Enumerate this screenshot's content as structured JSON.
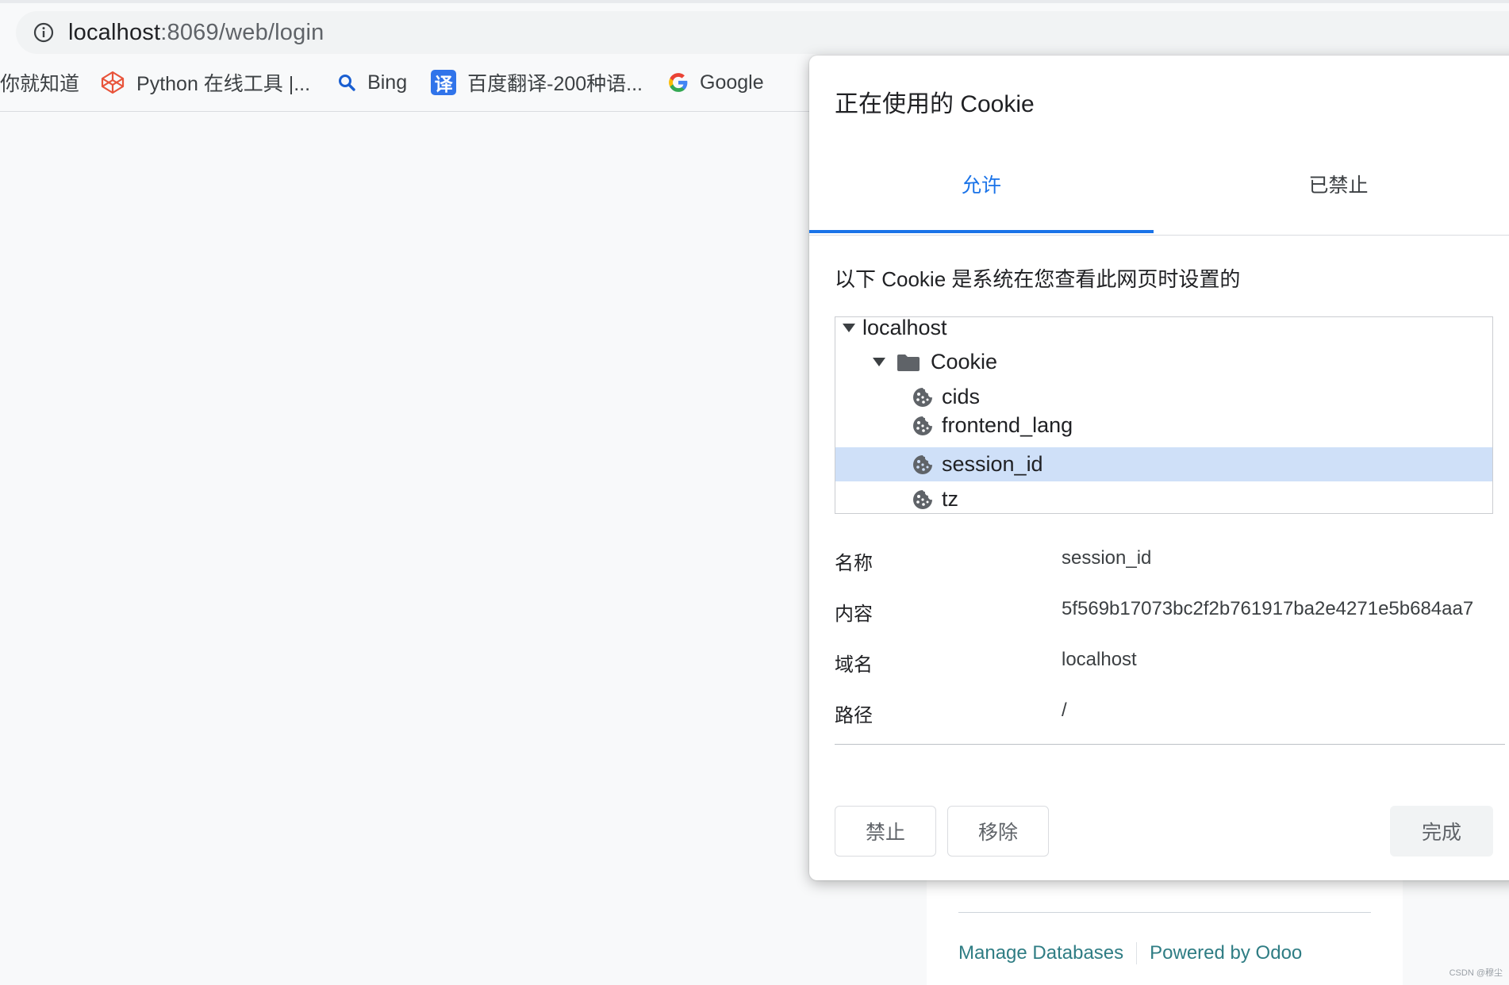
{
  "browser": {
    "url_host": "localhost",
    "url_rest": ":8069/web/login",
    "bookmarks": [
      {
        "label": "你就知道",
        "icon": "none"
      },
      {
        "label": "Python 在线工具 |...",
        "icon": "codepen-cube-icon"
      },
      {
        "label": "Bing",
        "icon": "search-icon"
      },
      {
        "label": "百度翻译-200种语...",
        "icon": "translate-icon",
        "icon_text": "译"
      },
      {
        "label": "Google",
        "icon": "google-g-icon"
      }
    ]
  },
  "dialog": {
    "title": "正在使用的 Cookie",
    "tabs": [
      {
        "label": "允许",
        "active": true
      },
      {
        "label": "已禁止",
        "active": false
      }
    ],
    "description": "以下 Cookie 是系统在您查看此网页时设置的",
    "tree": {
      "domain": "localhost",
      "folder": "Cookie",
      "cookies": [
        {
          "name": "cids",
          "selected": false
        },
        {
          "name": "frontend_lang",
          "selected": false
        },
        {
          "name": "session_id",
          "selected": true
        },
        {
          "name": "tz",
          "selected": false
        }
      ]
    },
    "details": [
      {
        "label": "名称",
        "value": "session_id"
      },
      {
        "label": "内容",
        "value": "5f569b17073bc2f2b761917ba2e4271e5b684aa7"
      },
      {
        "label": "域名",
        "value": "localhost"
      },
      {
        "label": "路径",
        "value": "/"
      }
    ],
    "buttons": {
      "block": "禁止",
      "remove": "移除",
      "done": "完成"
    }
  },
  "background": {
    "manage_databases": "Manage Databases",
    "powered_by": "Powered by Odoo"
  },
  "watermark": "CSDN @穆尘",
  "colors": {
    "accent": "#1a73e8",
    "selected_row": "#cfe0f8",
    "odoo_link": "#2f7d84"
  }
}
